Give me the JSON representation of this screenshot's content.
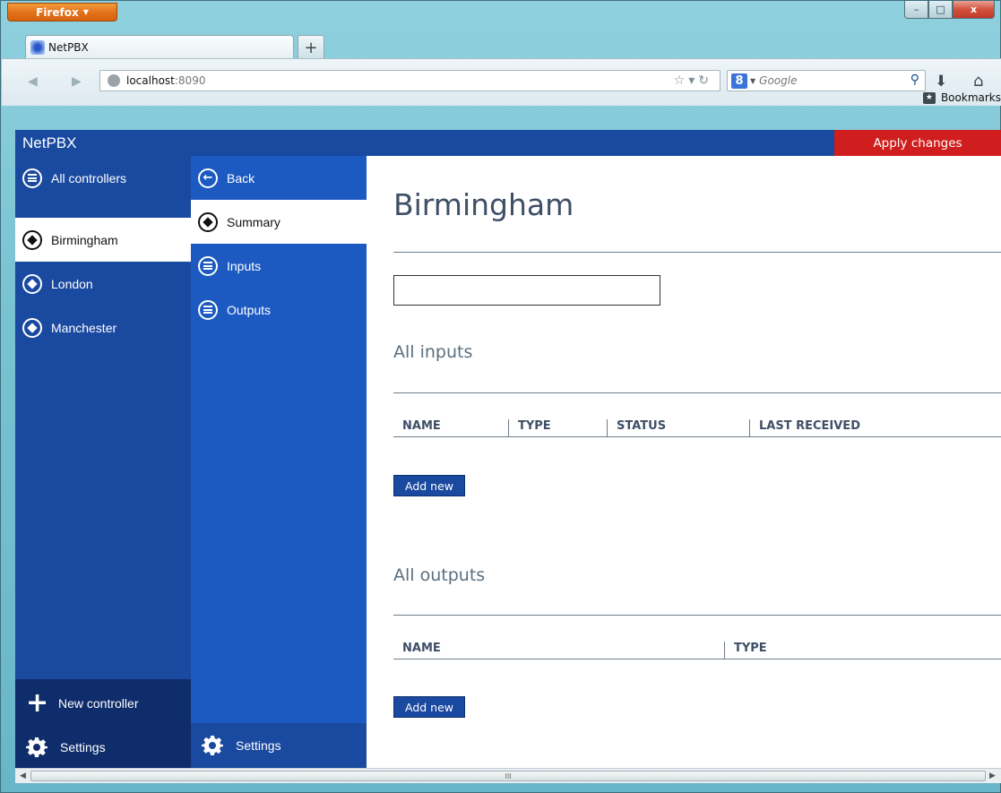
{
  "browser": {
    "menu_button": "Firefox",
    "tab_title": "NetPBX",
    "new_tab": "+",
    "url_host": "localhost",
    "url_port": ":8090",
    "search_engine_badge": "8",
    "search_placeholder": "Google",
    "bookmarks_label": "Bookmarks",
    "window_controls": {
      "minimize": "–",
      "maximize": "□",
      "close": "x"
    }
  },
  "app": {
    "title": "NetPBX",
    "apply_button": "Apply changes"
  },
  "controllers_column": {
    "all_controllers": "All controllers",
    "items": [
      {
        "label": "Birmingham",
        "active": true
      },
      {
        "label": "London",
        "active": false
      },
      {
        "label": "Manchester",
        "active": false
      }
    ],
    "new_controller": "New controller",
    "settings": "Settings"
  },
  "detail_column": {
    "back": "Back",
    "items": [
      {
        "label": "Summary",
        "active": true
      },
      {
        "label": "Inputs",
        "active": false
      },
      {
        "label": "Outputs",
        "active": false
      }
    ],
    "settings": "Settings"
  },
  "main": {
    "title": "Birmingham",
    "name_input_value": "",
    "inputs_section": {
      "title": "All inputs",
      "columns": [
        "NAME",
        "TYPE",
        "STATUS",
        "LAST RECEIVED"
      ],
      "add_button": "Add new"
    },
    "outputs_section": {
      "title": "All outputs",
      "columns": [
        "NAME",
        "TYPE"
      ],
      "add_button": "Add new"
    }
  },
  "scrollbar": {
    "grip": "III"
  },
  "colors": {
    "app_bar": "#1a49a0",
    "nav_secondary": "#1c5ac1",
    "apply": "#d01e1e",
    "footer_dark": "#0f2d6a"
  }
}
